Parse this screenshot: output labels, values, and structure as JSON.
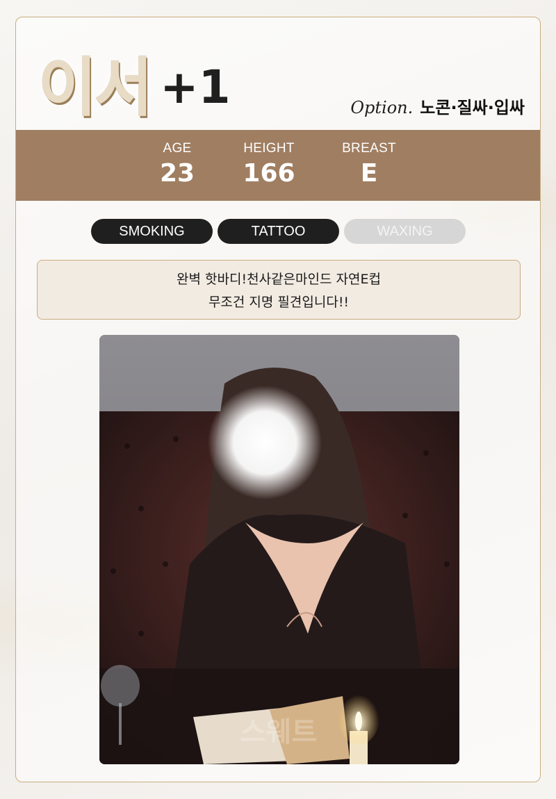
{
  "profile": {
    "name": "이서",
    "badge": "+1",
    "option_label": "Option.",
    "option_value": "노콘·질싸·입싸"
  },
  "stats": [
    {
      "label": "AGE",
      "value": "23"
    },
    {
      "label": "HEIGHT",
      "value": "166"
    },
    {
      "label": "BREAST",
      "value": "E"
    }
  ],
  "tags": [
    {
      "label": "SMOKING",
      "active": true
    },
    {
      "label": "TATTOO",
      "active": true
    },
    {
      "label": "WAXING",
      "active": false
    }
  ],
  "description": {
    "line1": "완벽 핫바디!천사같은마인드 자연E컵",
    "line2": "무조건 지명 필견입니다!!"
  },
  "photo": {
    "watermark": "스웨트"
  },
  "colors": {
    "accent": "#a07e61",
    "border": "#c9ad7e",
    "tag_active": "#1f1f1f",
    "tag_inactive": "#d6d6d6"
  }
}
